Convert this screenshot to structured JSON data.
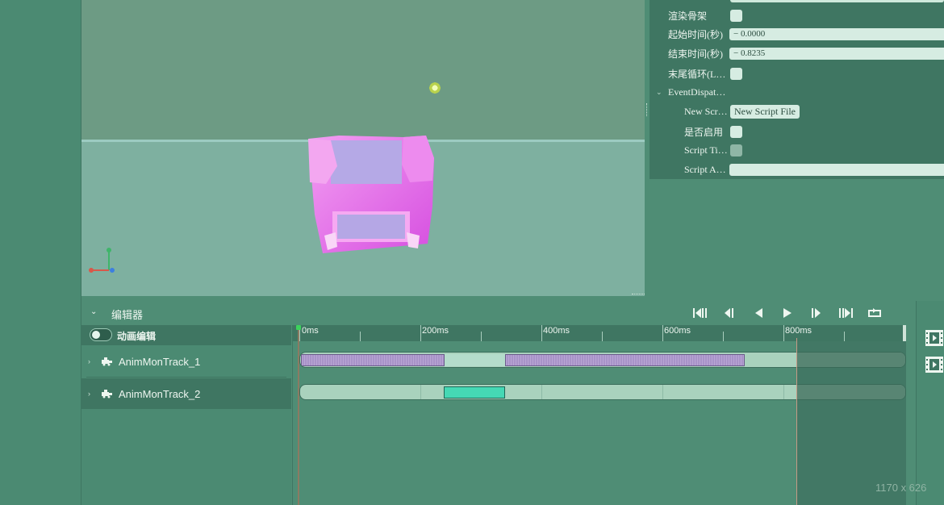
{
  "properties": {
    "rows": [
      {
        "label": "渲染骨架",
        "type": "checkbox"
      },
      {
        "label": "起始时间(秒)",
        "type": "number",
        "value": "0.0000"
      },
      {
        "label": "结束时间(秒)",
        "type": "number",
        "value": "0.8235"
      },
      {
        "label": "末尾循环(L…",
        "type": "checkbox"
      }
    ],
    "group": {
      "label": "EventDispat…",
      "rows": [
        {
          "label": "New Scr…",
          "button_label": "New Script File"
        },
        {
          "label": "是否启用",
          "type": "checkbox"
        },
        {
          "label": "Script Ti…",
          "type": "checkbox"
        },
        {
          "label": "Script A…",
          "type": "text",
          "value": ""
        }
      ]
    },
    "stepper_minus": "−"
  },
  "editor": {
    "title": "编辑器",
    "toggle_label": "动画编辑",
    "tracks": [
      {
        "name": "AnimMonTrack_1"
      },
      {
        "name": "AnimMonTrack_2"
      }
    ],
    "ruler_labels": [
      "0ms",
      "200ms",
      "400ms",
      "600ms",
      "800ms"
    ],
    "playback_controls": [
      "skip-to-start-icon",
      "step-back-icon",
      "play-reverse-icon",
      "play-icon",
      "step-forward-icon",
      "skip-to-end-icon",
      "loop-icon"
    ]
  },
  "status": {
    "size_label": "1170 x 626"
  }
}
